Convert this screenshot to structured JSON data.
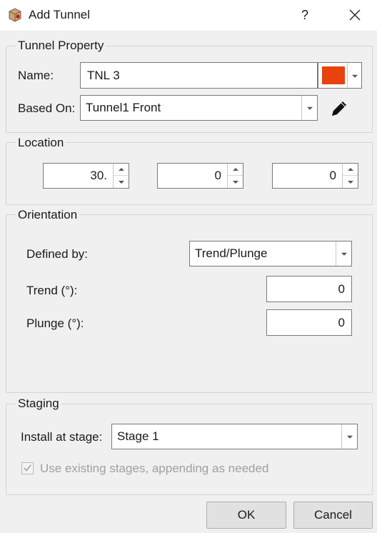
{
  "window": {
    "title": "Add Tunnel",
    "help": "?"
  },
  "tunnel_property": {
    "label": "Tunnel Property",
    "name_label": "Name:",
    "name_value": "TNL 3",
    "color": "#e8420e",
    "based_on_label": "Based On:",
    "based_on_value": "Tunnel1 Front"
  },
  "location": {
    "label": "Location",
    "values": [
      "30.",
      "0",
      "0"
    ]
  },
  "orientation": {
    "label": "Orientation",
    "defined_by_label": "Defined by:",
    "defined_by_value": "Trend/Plunge",
    "trend_label": "Trend (°):",
    "trend_value": "0",
    "plunge_label": "Plunge (°):",
    "plunge_value": "0"
  },
  "staging": {
    "label": "Staging",
    "install_label": "Install at stage:",
    "install_value": "Stage 1",
    "append_label": "Use existing stages, appending as needed",
    "append_checked": true
  },
  "buttons": {
    "ok": "OK",
    "cancel": "Cancel"
  },
  "icons": {
    "app": "tunnel-app-icon",
    "close": "close-icon",
    "edit": "pencil-icon",
    "dropdown": "chevron-down-icon"
  }
}
